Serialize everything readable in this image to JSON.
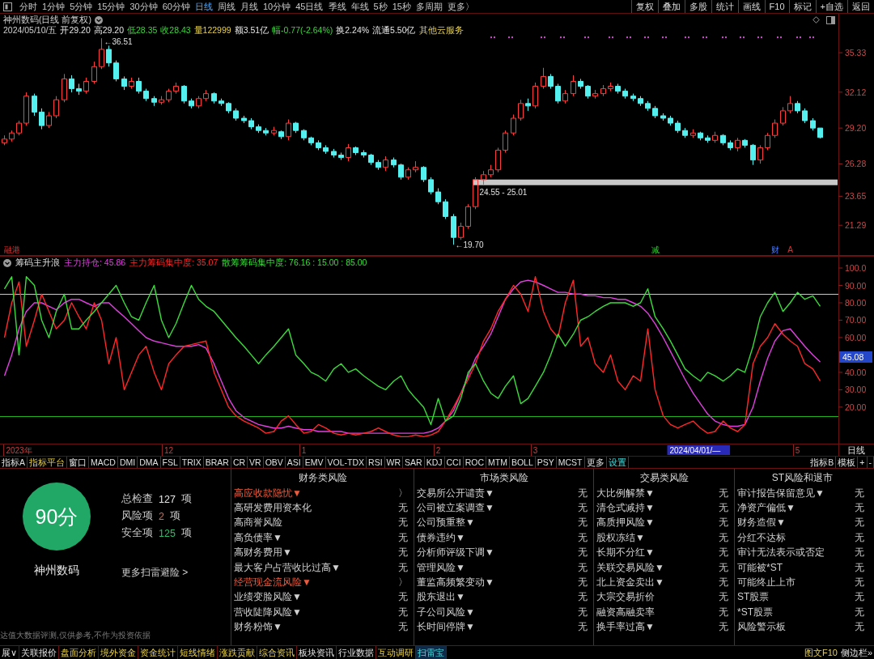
{
  "toolbar": {
    "periods": [
      {
        "label": "分时",
        "selected": false
      },
      {
        "label": "1分钟",
        "selected": false
      },
      {
        "label": "5分钟",
        "selected": false
      },
      {
        "label": "15分钟",
        "selected": false
      },
      {
        "label": "30分钟",
        "selected": false
      },
      {
        "label": "60分钟",
        "selected": false
      },
      {
        "label": "日线",
        "selected": true
      },
      {
        "label": "周线",
        "selected": false
      },
      {
        "label": "月线",
        "selected": false
      },
      {
        "label": "10分钟",
        "selected": false
      },
      {
        "label": "45日线",
        "selected": false
      },
      {
        "label": "季线",
        "selected": false
      },
      {
        "label": "年线",
        "selected": false
      },
      {
        "label": "5秒",
        "selected": false
      },
      {
        "label": "15秒",
        "selected": false
      },
      {
        "label": "多周期",
        "selected": false
      },
      {
        "label": "更多〉",
        "selected": false
      }
    ],
    "actions": [
      "复权",
      "叠加",
      "多股",
      "统计",
      "画线",
      "F10",
      "标记",
      "+自选",
      "返回"
    ]
  },
  "quote": {
    "title": "神州数码(日线 前复权)",
    "date": "2024/05/10/五",
    "fields": [
      {
        "text": "开29.20",
        "kind": "flat"
      },
      {
        "text": "高29.20",
        "kind": "flat"
      },
      {
        "text": "低28.35",
        "kind": "down"
      },
      {
        "text": "收28.43",
        "kind": "down"
      },
      {
        "text": "量122999",
        "kind": "volume"
      },
      {
        "text": "额3.51亿",
        "kind": "flat"
      },
      {
        "text": "幅-0.77(-2.64%)",
        "kind": "down"
      },
      {
        "text": "换2.24%",
        "kind": "flat"
      },
      {
        "text": "流通5.50亿",
        "kind": "flat"
      }
    ],
    "sector": "其他云服务"
  },
  "price_chart": {
    "markers": [
      {
        "kind": "alert"
      },
      {
        "kind": "sell"
      },
      {
        "kind": "report"
      },
      {
        "kind": "alert"
      }
    ],
    "chart_data": [
      {
        "type": "candlestick",
        "categories": [
          null,
          "融港",
          null,
          null,
          null,
          null,
          null,
          null,
          null,
          null,
          null,
          null,
          null,
          null,
          null,
          null,
          null,
          null,
          null,
          null,
          null,
          null,
          null,
          null,
          null,
          null,
          null,
          null,
          null,
          null,
          null,
          null,
          null,
          null,
          null,
          null,
          null,
          null,
          null,
          null,
          null,
          null,
          null,
          null,
          null,
          null,
          null,
          null,
          null,
          null,
          null,
          null,
          null,
          null,
          null,
          null,
          null,
          null,
          null,
          null,
          null,
          null,
          null,
          null,
          null,
          null,
          null,
          null,
          null,
          null,
          null,
          null,
          null,
          null,
          null,
          null,
          null,
          null,
          null,
          null,
          null,
          null,
          null,
          null,
          null,
          null,
          null,
          "减",
          null,
          null,
          null,
          null,
          null,
          null,
          null,
          null,
          null,
          null,
          null,
          null,
          null,
          null,
          null,
          "财",
          null,
          "A",
          null,
          null,
          null,
          null
        ],
        "ohlc": [
          [
            28.0,
            28.6,
            27.8,
            28.3
          ],
          [
            28.3,
            29.0,
            28.1,
            28.8
          ],
          [
            28.8,
            29.8,
            28.6,
            29.6
          ],
          [
            29.6,
            32.1,
            29.4,
            31.8
          ],
          [
            31.8,
            32.0,
            30.2,
            30.5
          ],
          [
            30.5,
            30.8,
            29.1,
            29.4
          ],
          [
            29.4,
            30.5,
            29.2,
            30.2
          ],
          [
            30.2,
            31.8,
            30.0,
            31.5
          ],
          [
            31.5,
            33.6,
            31.3,
            33.2
          ],
          [
            33.2,
            33.5,
            32.1,
            32.4
          ],
          [
            32.4,
            32.8,
            31.9,
            32.2
          ],
          [
            32.2,
            33.3,
            32.0,
            33.0
          ],
          [
            33.0,
            34.6,
            32.8,
            34.2
          ],
          [
            34.2,
            36.51,
            34.0,
            35.6
          ],
          [
            35.6,
            35.9,
            34.2,
            34.5
          ],
          [
            34.5,
            34.7,
            33.0,
            33.2
          ],
          [
            33.2,
            33.4,
            32.3,
            32.6
          ],
          [
            32.6,
            33.3,
            32.4,
            33.0
          ],
          [
            33.0,
            33.3,
            32.0,
            32.2
          ],
          [
            32.2,
            32.4,
            31.4,
            31.6
          ],
          [
            31.6,
            31.8,
            31.0,
            31.3
          ],
          [
            31.3,
            31.8,
            31.1,
            31.5
          ],
          [
            31.5,
            32.4,
            31.3,
            32.2
          ],
          [
            32.2,
            32.9,
            32.0,
            32.6
          ],
          [
            32.6,
            32.7,
            31.2,
            31.4
          ],
          [
            31.4,
            31.6,
            30.8,
            31.0
          ],
          [
            31.0,
            31.8,
            30.8,
            31.6
          ],
          [
            31.6,
            32.3,
            31.4,
            32.0
          ],
          [
            32.0,
            32.1,
            31.2,
            31.4
          ],
          [
            31.4,
            31.6,
            31.0,
            31.2
          ],
          [
            31.2,
            31.3,
            30.4,
            30.6
          ],
          [
            30.6,
            30.8,
            29.8,
            30.0
          ],
          [
            30.0,
            30.2,
            29.6,
            29.8
          ],
          [
            29.8,
            30.0,
            29.1,
            29.3
          ],
          [
            29.3,
            29.5,
            28.8,
            29.0
          ],
          [
            29.0,
            29.2,
            28.6,
            28.8
          ],
          [
            28.8,
            29.3,
            28.6,
            29.0
          ],
          [
            28.9,
            29.0,
            28.3,
            28.5
          ],
          [
            28.5,
            29.9,
            28.2,
            29.6
          ],
          [
            29.6,
            29.7,
            28.8,
            29.0
          ],
          [
            29.0,
            29.1,
            28.2,
            28.4
          ],
          [
            28.4,
            28.5,
            27.8,
            28.0
          ],
          [
            28.0,
            28.2,
            27.4,
            27.6
          ],
          [
            27.6,
            27.8,
            27.1,
            27.3
          ],
          [
            27.3,
            27.5,
            26.8,
            27.0
          ],
          [
            27.0,
            27.2,
            26.6,
            26.8
          ],
          [
            26.8,
            27.9,
            26.5,
            27.6
          ],
          [
            27.6,
            27.7,
            27.0,
            27.2
          ],
          [
            27.2,
            27.4,
            26.8,
            27.0
          ],
          [
            27.0,
            27.1,
            26.2,
            26.4
          ],
          [
            26.4,
            26.6,
            25.8,
            26.0
          ],
          [
            26.0,
            26.9,
            25.7,
            26.6
          ],
          [
            26.6,
            26.8,
            26.0,
            26.2
          ],
          [
            26.2,
            26.3,
            25.0,
            25.2
          ],
          [
            25.2,
            26.0,
            25.0,
            25.8
          ],
          [
            25.8,
            26.5,
            25.6,
            26.0
          ],
          [
            26.0,
            26.1,
            24.8,
            25.0
          ],
          [
            25.0,
            25.2,
            23.8,
            24.0
          ],
          [
            24.0,
            24.3,
            23.0,
            23.2
          ],
          [
            23.2,
            23.4,
            21.8,
            22.0
          ],
          [
            22.0,
            22.2,
            19.7,
            20.3
          ],
          [
            20.3,
            21.5,
            20.1,
            21.2
          ],
          [
            21.2,
            23.0,
            21.0,
            22.8
          ],
          [
            22.8,
            25.2,
            22.6,
            25.0
          ],
          [
            25.0,
            25.7,
            24.6,
            25.4
          ],
          [
            25.4,
            26.2,
            25.2,
            25.8
          ],
          [
            25.8,
            27.6,
            25.6,
            27.4
          ],
          [
            27.4,
            29.0,
            27.2,
            28.8
          ],
          [
            28.8,
            30.3,
            28.6,
            30.0
          ],
          [
            30.0,
            31.5,
            29.8,
            31.2
          ],
          [
            31.2,
            31.6,
            30.6,
            31.0
          ],
          [
            31.0,
            32.9,
            30.8,
            32.6
          ],
          [
            32.6,
            34.1,
            32.4,
            33.4
          ],
          [
            33.4,
            33.6,
            32.4,
            32.6
          ],
          [
            32.6,
            32.8,
            31.2,
            31.4
          ],
          [
            31.4,
            32.3,
            31.2,
            32.0
          ],
          [
            32.0,
            33.5,
            31.8,
            33.0
          ],
          [
            33.0,
            33.2,
            32.4,
            32.6
          ],
          [
            32.6,
            32.7,
            31.6,
            31.8
          ],
          [
            31.8,
            32.3,
            31.6,
            32.0
          ],
          [
            32.0,
            32.7,
            31.8,
            32.4
          ],
          [
            32.4,
            32.9,
            32.2,
            32.6
          ],
          [
            32.6,
            32.8,
            32.0,
            32.2
          ],
          [
            32.2,
            32.4,
            31.6,
            31.8
          ],
          [
            31.8,
            32.0,
            31.4,
            31.6
          ],
          [
            31.6,
            31.8,
            31.0,
            31.2
          ],
          [
            31.2,
            31.4,
            30.6,
            30.8
          ],
          [
            30.8,
            31.0,
            30.0,
            30.2
          ],
          [
            30.2,
            30.4,
            29.8,
            30.0
          ],
          [
            30.0,
            30.2,
            29.4,
            29.6
          ],
          [
            29.6,
            29.8,
            28.8,
            29.0
          ],
          [
            29.0,
            29.2,
            28.4,
            28.6
          ],
          [
            28.6,
            29.1,
            28.4,
            28.8
          ],
          [
            28.8,
            28.9,
            28.2,
            28.4
          ],
          [
            28.4,
            28.6,
            28.0,
            28.2
          ],
          [
            28.2,
            28.9,
            28.0,
            28.6
          ],
          [
            28.6,
            28.7,
            27.8,
            28.0
          ],
          [
            28.0,
            28.2,
            27.4,
            27.6
          ],
          [
            27.6,
            28.4,
            27.3,
            28.2
          ],
          [
            28.2,
            28.3,
            27.6,
            27.8
          ],
          [
            27.8,
            27.9,
            26.2,
            26.6
          ],
          [
            26.6,
            27.8,
            26.3,
            27.6
          ],
          [
            27.6,
            28.8,
            27.4,
            28.6
          ],
          [
            28.6,
            29.9,
            28.4,
            29.6
          ],
          [
            29.6,
            30.9,
            29.4,
            30.6
          ],
          [
            30.6,
            31.8,
            30.4,
            31.2
          ],
          [
            31.2,
            31.4,
            30.4,
            30.6
          ],
          [
            30.6,
            30.8,
            29.6,
            29.8
          ],
          [
            29.8,
            30.0,
            29.0,
            29.2
          ],
          [
            29.2,
            29.2,
            28.35,
            28.43
          ]
        ],
        "ylim": [
          18.8,
          38.5
        ],
        "yticks": [
          {
            "value": 35.33,
            "label": "35.33"
          },
          {
            "value": 32.12,
            "label": "32.12"
          },
          {
            "value": 29.2,
            "label": "29.20"
          },
          {
            "value": 26.28,
            "label": "26.28"
          },
          {
            "value": 23.65,
            "label": "23.65"
          },
          {
            "value": 21.29,
            "label": "21.29"
          }
        ],
        "bands": [
          {
            "axis": "y",
            "from": 24.55,
            "to": 25.01,
            "label": "24.55 - 25.01",
            "color": "#c8c8c8"
          }
        ],
        "annotations": [
          "←36.51",
          "←19.70"
        ]
      }
    ]
  },
  "indicator": {
    "readings": [
      ": 45.86",
      ": 35.07",
      ": 76.16 : 15.00 : 85.00"
    ],
    "cursor_date": "2024/04/01/—",
    "value_tag": "45.08",
    "period_label": "日线",
    "chart_data": [
      {
        "type": "line",
        "title": "筹码主升浪",
        "categories": [
          null,
          null,
          "2023年",
          null,
          null,
          null,
          null,
          null,
          null,
          null,
          null,
          null,
          null,
          null,
          null,
          null,
          null,
          null,
          null,
          null,
          null,
          null,
          "12",
          null,
          null,
          null,
          null,
          null,
          null,
          null,
          null,
          null,
          null,
          null,
          null,
          null,
          null,
          null,
          null,
          null,
          "1",
          null,
          null,
          null,
          null,
          null,
          null,
          null,
          null,
          null,
          null,
          null,
          null,
          null,
          null,
          null,
          null,
          null,
          "2",
          null,
          null,
          null,
          null,
          null,
          null,
          null,
          null,
          null,
          null,
          null,
          null,
          "3",
          null,
          null,
          null,
          null,
          null,
          null,
          null,
          null,
          null,
          null,
          null,
          null,
          null,
          null,
          null,
          null,
          null,
          null,
          null,
          null,
          null,
          null,
          null,
          null,
          null,
          null,
          null,
          null,
          null,
          null,
          null,
          null,
          null,
          null,
          "5",
          null,
          null,
          null
        ],
        "series": [
          {
            "name": "主力持仓",
            "color": "#e040e0",
            "values": [
              38,
              50,
              65,
              75,
              80,
              80,
              78,
              76,
              80,
              82,
              82,
              80,
              78,
              80,
              80,
              76,
              72,
              68,
              64,
              60,
              58,
              57,
              56,
              55,
              55,
              55,
              56,
              54,
              45,
              35,
              25,
              18,
              14,
              12,
              10,
              9,
              8,
              8,
              9,
              8,
              7,
              7,
              6,
              6,
              6,
              6,
              5,
              5,
              5,
              5,
              5,
              5,
              5,
              5,
              5,
              5,
              5,
              6,
              8,
              12,
              18,
              28,
              38,
              48,
              55,
              62,
              72,
              82,
              88,
              92,
              93,
              92,
              90,
              88,
              86,
              86,
              85,
              85,
              84,
              84,
              83,
              83,
              82,
              82,
              80,
              78,
              74,
              68,
              60,
              52,
              44,
              36,
              28,
              22,
              16,
              12,
              10,
              9,
              9,
              10,
              20,
              35,
              48,
              58,
              64,
              65,
              60,
              55,
              50,
              46
            ]
          },
          {
            "name": "主力筹码集中度",
            "color": "#ff2828",
            "values": [
              60,
              80,
              92,
              55,
              70,
              85,
              75,
              65,
              70,
              80,
              72,
              65,
              80,
              70,
              45,
              60,
              30,
              40,
              50,
              55,
              40,
              30,
              45,
              50,
              55,
              56,
              57,
              58,
              40,
              30,
              20,
              15,
              12,
              10,
              8,
              5,
              6,
              12,
              15,
              10,
              5,
              6,
              10,
              8,
              5,
              4,
              5,
              4,
              5,
              6,
              8,
              6,
              4,
              3,
              3,
              4,
              3,
              4,
              6,
              12,
              20,
              28,
              36,
              45,
              58,
              65,
              75,
              82,
              90,
              85,
              75,
              95,
              75,
              65,
              60,
              80,
              93,
              55,
              60,
              45,
              40,
              50,
              35,
              30,
              38,
              35,
              65,
              30,
              15,
              10,
              8,
              10,
              12,
              8,
              5,
              6,
              12,
              8,
              6,
              10,
              45,
              55,
              60,
              68,
              62,
              58,
              55,
              45,
              42,
              35
            ]
          },
          {
            "name": "散筹筹码集中度",
            "color": "#3cdc3c",
            "values": [
              88,
              95,
              50,
              95,
              90,
              70,
              60,
              75,
              85,
              65,
              65,
              70,
              75,
              80,
              85,
              90,
              80,
              72,
              70,
              80,
              90,
              70,
              60,
              68,
              80,
              90,
              82,
              78,
              75,
              70,
              65,
              60,
              55,
              50,
              45,
              50,
              55,
              60,
              65,
              50,
              45,
              40,
              38,
              35,
              42,
              45,
              40,
              42,
              38,
              35,
              32,
              30,
              35,
              38,
              30,
              25,
              20,
              10,
              25,
              12,
              15,
              25,
              40,
              45,
              35,
              28,
              25,
              32,
              38,
              22,
              25,
              32,
              40,
              50,
              62,
              55,
              62,
              70,
              72,
              75,
              78,
              80,
              80,
              80,
              78,
              80,
              88,
              72,
              65,
              58,
              50,
              42,
              38,
              35,
              40,
              38,
              35,
              38,
              42,
              40,
              55,
              72,
              80,
              86,
              75,
              80,
              86,
              82,
              84,
              78
            ]
          }
        ],
        "ylim": [
          -1,
          107
        ],
        "yticks": [
          {
            "value": 100,
            "label": "100.0"
          },
          {
            "value": 90,
            "label": "90.00"
          },
          {
            "value": 80,
            "label": "80.00"
          },
          {
            "value": 70,
            "label": "70.00"
          },
          {
            "value": 60,
            "label": "60.00"
          },
          {
            "value": 40,
            "label": "40.00"
          },
          {
            "value": 30,
            "label": "30.00"
          },
          {
            "value": 20,
            "label": "20.00"
          }
        ],
        "ref_lines": [
          {
            "axis": "y",
            "value": 85,
            "color": "#c8c8c8"
          },
          {
            "axis": "y",
            "value": 15,
            "color": "#20b020"
          }
        ]
      }
    ]
  },
  "indicator_tabs": {
    "left": [
      {
        "label": "指标A",
        "kind": "plain"
      },
      {
        "label": "指标平台",
        "kind": "feature"
      },
      {
        "label": "窗口",
        "kind": "plain"
      },
      {
        "label": "MACD",
        "kind": "plain"
      },
      {
        "label": "DMI",
        "kind": "plain"
      },
      {
        "label": "DMA",
        "kind": "plain"
      },
      {
        "label": "FSL",
        "kind": "plain"
      },
      {
        "label": "TRIX",
        "kind": "plain"
      },
      {
        "label": "BRAR",
        "kind": "plain"
      },
      {
        "label": "CR",
        "kind": "plain"
      },
      {
        "label": "VR",
        "kind": "plain"
      },
      {
        "label": "OBV",
        "kind": "plain"
      },
      {
        "label": "ASI",
        "kind": "plain"
      },
      {
        "label": "EMV",
        "kind": "plain"
      },
      {
        "label": "VOL-TDX",
        "kind": "plain"
      },
      {
        "label": "RSI",
        "kind": "plain"
      },
      {
        "label": "WR",
        "kind": "plain"
      },
      {
        "label": "SAR",
        "kind": "plain"
      },
      {
        "label": "KDJ",
        "kind": "plain"
      },
      {
        "label": "CCI",
        "kind": "plain"
      },
      {
        "label": "ROC",
        "kind": "plain"
      },
      {
        "label": "MTM",
        "kind": "plain"
      },
      {
        "label": "BOLL",
        "kind": "plain"
      },
      {
        "label": "PSY",
        "kind": "plain"
      },
      {
        "label": "MCST",
        "kind": "plain"
      },
      {
        "label": "更多",
        "kind": "plain"
      },
      {
        "label": "设置",
        "kind": "setting"
      }
    ],
    "right": [
      "指标B",
      "模板",
      "+",
      "-"
    ]
  },
  "risk_scan": {
    "score": "90分",
    "stock": "神州数码",
    "stats": [
      {
        "label": "总检查",
        "value": "127",
        "unit": "项",
        "kind": "total"
      },
      {
        "label": "风险项",
        "value": "2",
        "unit": "项",
        "kind": "risk"
      },
      {
        "label": "安全项",
        "value": "125",
        "unit": "项",
        "kind": "safe"
      }
    ],
    "more_link": "更多扫雷避险 >",
    "disclaimer": "达值大数据评测,仅供参考,不作为投资依据",
    "columns": [
      {
        "title": "财务类风险",
        "items": [
          {
            "label": "高应收款隐忧▼",
            "result": "〉",
            "flagged": true
          },
          {
            "label": "高研发费用资本化",
            "result": "无",
            "flagged": false
          },
          {
            "label": "高商誉风险",
            "result": "无",
            "flagged": false
          },
          {
            "label": "高负债率▼",
            "result": "无",
            "flagged": false
          },
          {
            "label": "高财务费用▼",
            "result": "无",
            "flagged": false
          },
          {
            "label": "最大客户占营收比过高▼",
            "result": "无",
            "flagged": false
          },
          {
            "label": "经营现金流风险▼",
            "result": "〉",
            "flagged": true
          },
          {
            "label": "业绩变脸风险▼",
            "result": "无",
            "flagged": false
          },
          {
            "label": "营收陡降风险▼",
            "result": "无",
            "flagged": false
          },
          {
            "label": "财务粉饰▼",
            "result": "无",
            "flagged": false
          }
        ]
      },
      {
        "title": "市场类风险",
        "items": [
          {
            "label": "交易所公开谴责▼",
            "result": "无",
            "flagged": false
          },
          {
            "label": "公司被立案调查▼",
            "result": "无",
            "flagged": false
          },
          {
            "label": "公司预重整▼",
            "result": "无",
            "flagged": false
          },
          {
            "label": "债券违约▼",
            "result": "无",
            "flagged": false
          },
          {
            "label": "分析师评级下调▼",
            "result": "无",
            "flagged": false
          },
          {
            "label": "管理风险▼",
            "result": "无",
            "flagged": false
          },
          {
            "label": "董监高频繁变动▼",
            "result": "无",
            "flagged": false
          },
          {
            "label": "股东退出▼",
            "result": "无",
            "flagged": false
          },
          {
            "label": "子公司风险▼",
            "result": "无",
            "flagged": false
          },
          {
            "label": "长时间停牌▼",
            "result": "无",
            "flagged": false
          }
        ]
      },
      {
        "title": "交易类风险",
        "items": [
          {
            "label": "大比例解禁▼",
            "result": "无",
            "flagged": false
          },
          {
            "label": "清仓式减持▼",
            "result": "无",
            "flagged": false
          },
          {
            "label": "高质押风险▼",
            "result": "无",
            "flagged": false
          },
          {
            "label": "股权冻结▼",
            "result": "无",
            "flagged": false
          },
          {
            "label": "长期不分红▼",
            "result": "无",
            "flagged": false
          },
          {
            "label": "关联交易风险▼",
            "result": "无",
            "flagged": false
          },
          {
            "label": "北上资金卖出▼",
            "result": "无",
            "flagged": false
          },
          {
            "label": "大宗交易折价",
            "result": "无",
            "flagged": false
          },
          {
            "label": "融资高融卖率",
            "result": "无",
            "flagged": false
          },
          {
            "label": "换手率过高▼",
            "result": "无",
            "flagged": false
          }
        ]
      },
      {
        "title": "ST风险和退市",
        "items": [
          {
            "label": "审计报告保留意见▼",
            "result": "无",
            "flagged": false
          },
          {
            "label": "净资产偏低▼",
            "result": "无",
            "flagged": false
          },
          {
            "label": "财务造假▼",
            "result": "无",
            "flagged": false
          },
          {
            "label": "分红不达标",
            "result": "无",
            "flagged": false
          },
          {
            "label": "审计无法表示或否定",
            "result": "无",
            "flagged": false
          },
          {
            "label": "可能被*ST",
            "result": "无",
            "flagged": false
          },
          {
            "label": "可能终止上市",
            "result": "无",
            "flagged": false
          },
          {
            "label": "ST股票",
            "result": "无",
            "flagged": false
          },
          {
            "label": "*ST股票",
            "result": "无",
            "flagged": false
          },
          {
            "label": "风险警示板",
            "result": "无",
            "flagged": false
          }
        ]
      }
    ]
  },
  "bottom_tabs": {
    "items": [
      {
        "label": "展∨",
        "kind": "plain",
        "selected": false
      },
      {
        "label": "关联报价",
        "kind": "plain",
        "selected": false
      },
      {
        "label": "盘面分析",
        "kind": "feature",
        "selected": false
      },
      {
        "label": "境外资金",
        "kind": "feature",
        "selected": false
      },
      {
        "label": "资金统计",
        "kind": "feature",
        "selected": false
      },
      {
        "label": "短线情绪",
        "kind": "feature",
        "selected": false
      },
      {
        "label": "涨跌贡献",
        "kind": "feature",
        "selected": false
      },
      {
        "label": "综合资讯",
        "kind": "feature",
        "selected": false
      },
      {
        "label": "板块资讯",
        "kind": "plain",
        "selected": false
      },
      {
        "label": "行业数据",
        "kind": "plain",
        "selected": false
      },
      {
        "label": "互动调研",
        "kind": "feature",
        "selected": false
      },
      {
        "label": "扫雷宝",
        "kind": "tool",
        "selected": true
      }
    ],
    "right": [
      {
        "label": "图文F10",
        "kind": "badge"
      },
      {
        "label": "侧边栏»",
        "kind": "plain"
      }
    ]
  }
}
